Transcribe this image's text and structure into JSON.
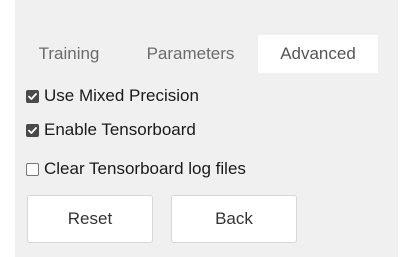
{
  "tabs": [
    {
      "label": "Training",
      "active": false
    },
    {
      "label": "Parameters",
      "active": false
    },
    {
      "label": "Advanced",
      "active": true
    }
  ],
  "options": [
    {
      "label": "Use Mixed Precision",
      "checked": true
    },
    {
      "label": "Enable Tensorboard",
      "checked": true
    },
    {
      "label": "Clear Tensorboard log files",
      "checked": false
    }
  ],
  "buttons": {
    "reset_label": "Reset",
    "back_label": "Back"
  },
  "colors": {
    "panel_background": "#f0f0f0",
    "active_tab_background": "#ffffff",
    "checkbox_checked": "#4a4a4a"
  },
  "icons": {
    "checkmark": "checkmark-icon"
  }
}
